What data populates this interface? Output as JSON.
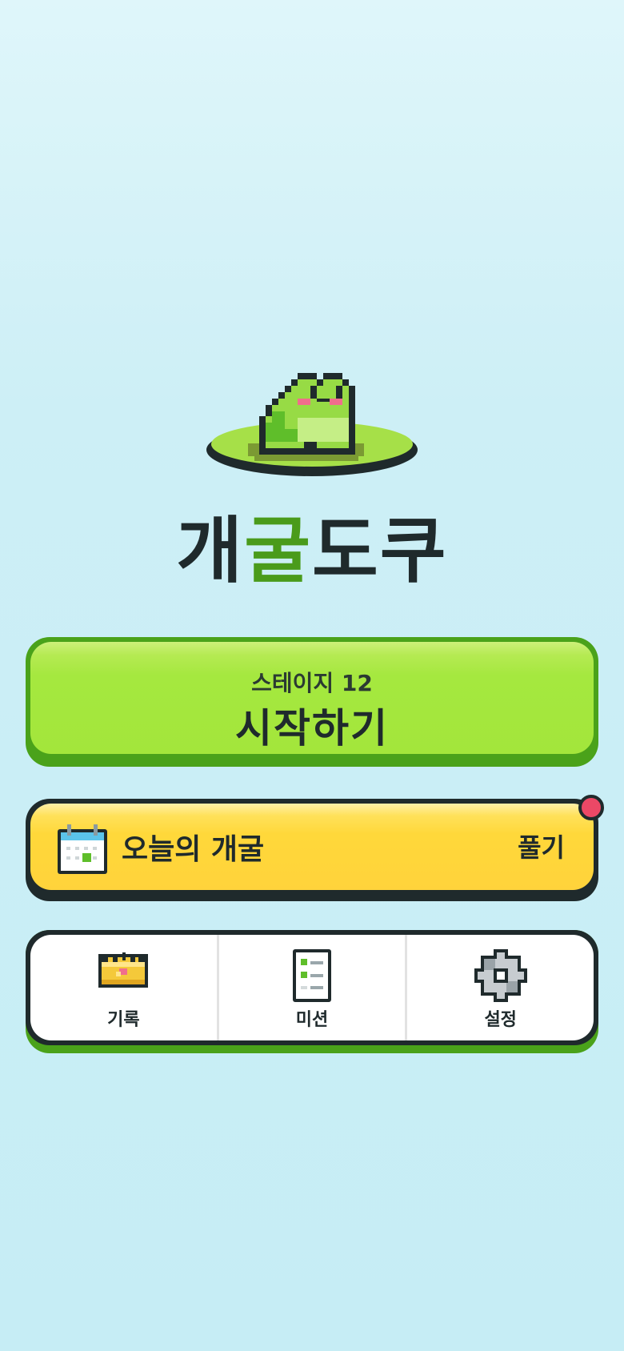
{
  "app": {
    "title_part1": "개",
    "title_accent": "굴",
    "title_part2": "도쿠"
  },
  "start_button": {
    "stage": "스테이지 12",
    "label": "시작하기"
  },
  "daily_button": {
    "label": "오늘의 개굴",
    "action": "풀기",
    "has_notification": true
  },
  "nav": {
    "items": [
      {
        "label": "기록",
        "icon": "crown-icon"
      },
      {
        "label": "미션",
        "icon": "checklist-icon"
      },
      {
        "label": "설정",
        "icon": "gear-icon"
      }
    ]
  },
  "colors": {
    "accent_green": "#4a9b1b",
    "start_face": "#a3e63b",
    "daily_face": "#ffd33b",
    "notification": "#ec4866",
    "ink": "#1f2a2c"
  }
}
